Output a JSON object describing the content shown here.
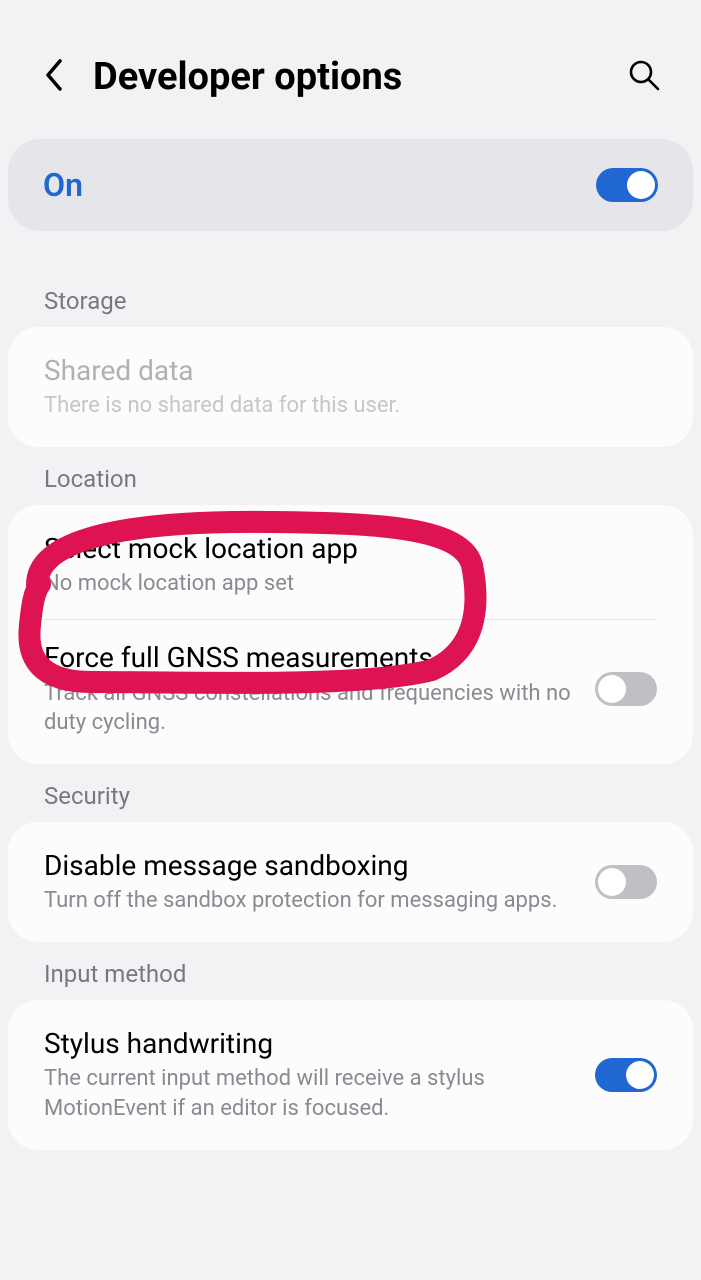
{
  "header": {
    "title": "Developer options"
  },
  "master": {
    "label": "On"
  },
  "sections": {
    "storage": {
      "header": "Storage",
      "shared_data": {
        "title": "Shared data",
        "subtitle": "There is no shared data for this user."
      }
    },
    "location": {
      "header": "Location",
      "mock": {
        "title": "Select mock location app",
        "subtitle": "No mock location app set"
      },
      "gnss": {
        "title": "Force full GNSS measurements",
        "subtitle": "Track all GNSS constellations and frequencies with no duty cycling."
      }
    },
    "security": {
      "header": "Security",
      "sandbox": {
        "title": "Disable message sandboxing",
        "subtitle": "Turn off the sandbox protection for messaging apps."
      }
    },
    "input": {
      "header": "Input method",
      "stylus": {
        "title": "Stylus handwriting",
        "subtitle": "The current input method will receive a stylus MotionEvent if an editor is focused."
      }
    }
  }
}
